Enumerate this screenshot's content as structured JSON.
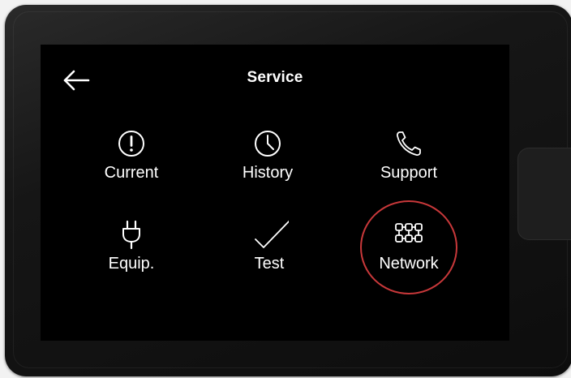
{
  "screen": {
    "title": "Service"
  },
  "menu": {
    "items": [
      {
        "label": "Current",
        "icon": "alert-circle-icon"
      },
      {
        "label": "History",
        "icon": "clock-icon"
      },
      {
        "label": "Support",
        "icon": "phone-icon"
      },
      {
        "label": "Equip.",
        "icon": "plug-icon"
      },
      {
        "label": "Test",
        "icon": "checkmark-icon"
      },
      {
        "label": "Network",
        "icon": "network-icon"
      }
    ],
    "highlighted": "Network"
  },
  "colors": {
    "screen_bg": "#000000",
    "text": "#ffffff",
    "highlight_ring": "#c8383a"
  }
}
